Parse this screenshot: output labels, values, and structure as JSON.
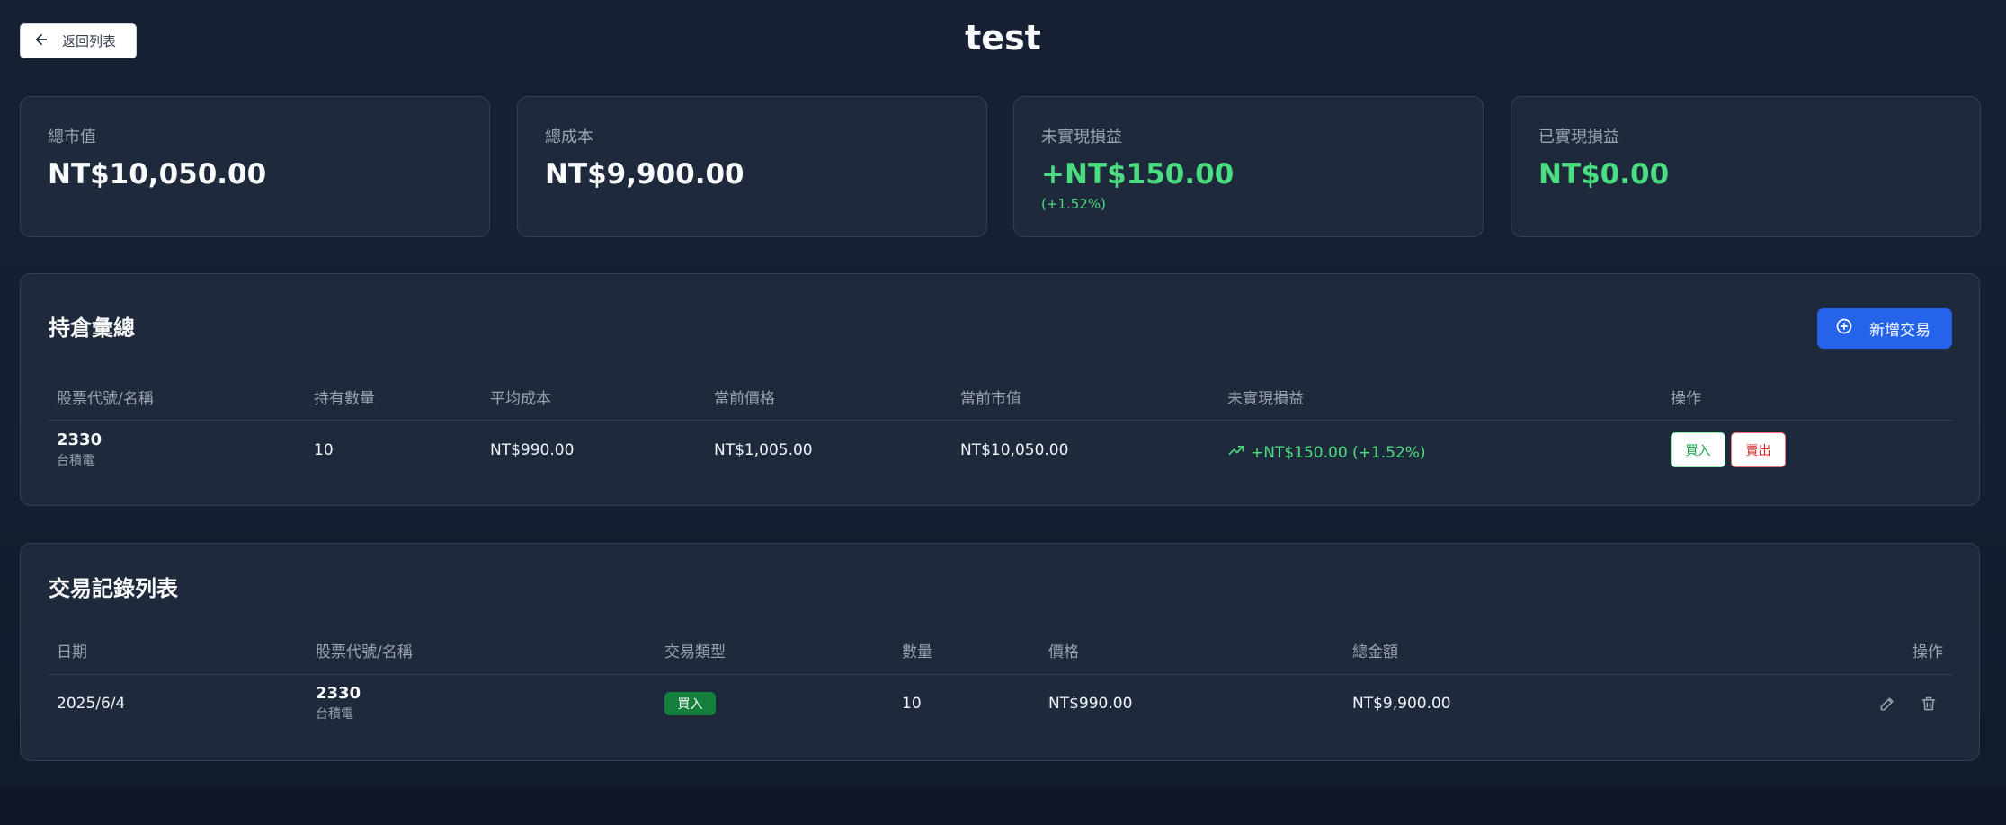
{
  "header": {
    "back_label": "返回列表",
    "title": "test"
  },
  "stats": [
    {
      "label": "總市值",
      "value": "NT$10,050.00"
    },
    {
      "label": "總成本",
      "value": "NT$9,900.00"
    },
    {
      "label": "未實現損益",
      "value": "+NT$150.00",
      "sub": "(+1.52%)"
    },
    {
      "label": "已實現損益",
      "value": "NT$0.00"
    }
  ],
  "holdings": {
    "title": "持倉彙總",
    "add_label": "新增交易",
    "columns": [
      "股票代號/名稱",
      "持有數量",
      "平均成本",
      "當前價格",
      "當前市值",
      "未實現損益",
      "操作"
    ],
    "rows": [
      {
        "code": "2330",
        "name": "台積電",
        "quantity": "10",
        "avg_cost": "NT$990.00",
        "price": "NT$1,005.00",
        "market_value": "NT$10,050.00",
        "pnl": "+NT$150.00 (+1.52%)",
        "buy_label": "買入",
        "sell_label": "賣出"
      }
    ]
  },
  "trades": {
    "title": "交易記錄列表",
    "columns": [
      "日期",
      "股票代號/名稱",
      "交易類型",
      "數量",
      "價格",
      "總金額",
      "操作"
    ],
    "rows": [
      {
        "date": "2025/6/4",
        "code": "2330",
        "name": "台積電",
        "type": "買入",
        "quantity": "10",
        "price": "NT$990.00",
        "total": "NT$9,900.00"
      }
    ]
  },
  "colors": {
    "accent": "#2563eb",
    "positive": "#4ade80",
    "negative": "#dc2626",
    "card_bg": "#1e293b"
  }
}
